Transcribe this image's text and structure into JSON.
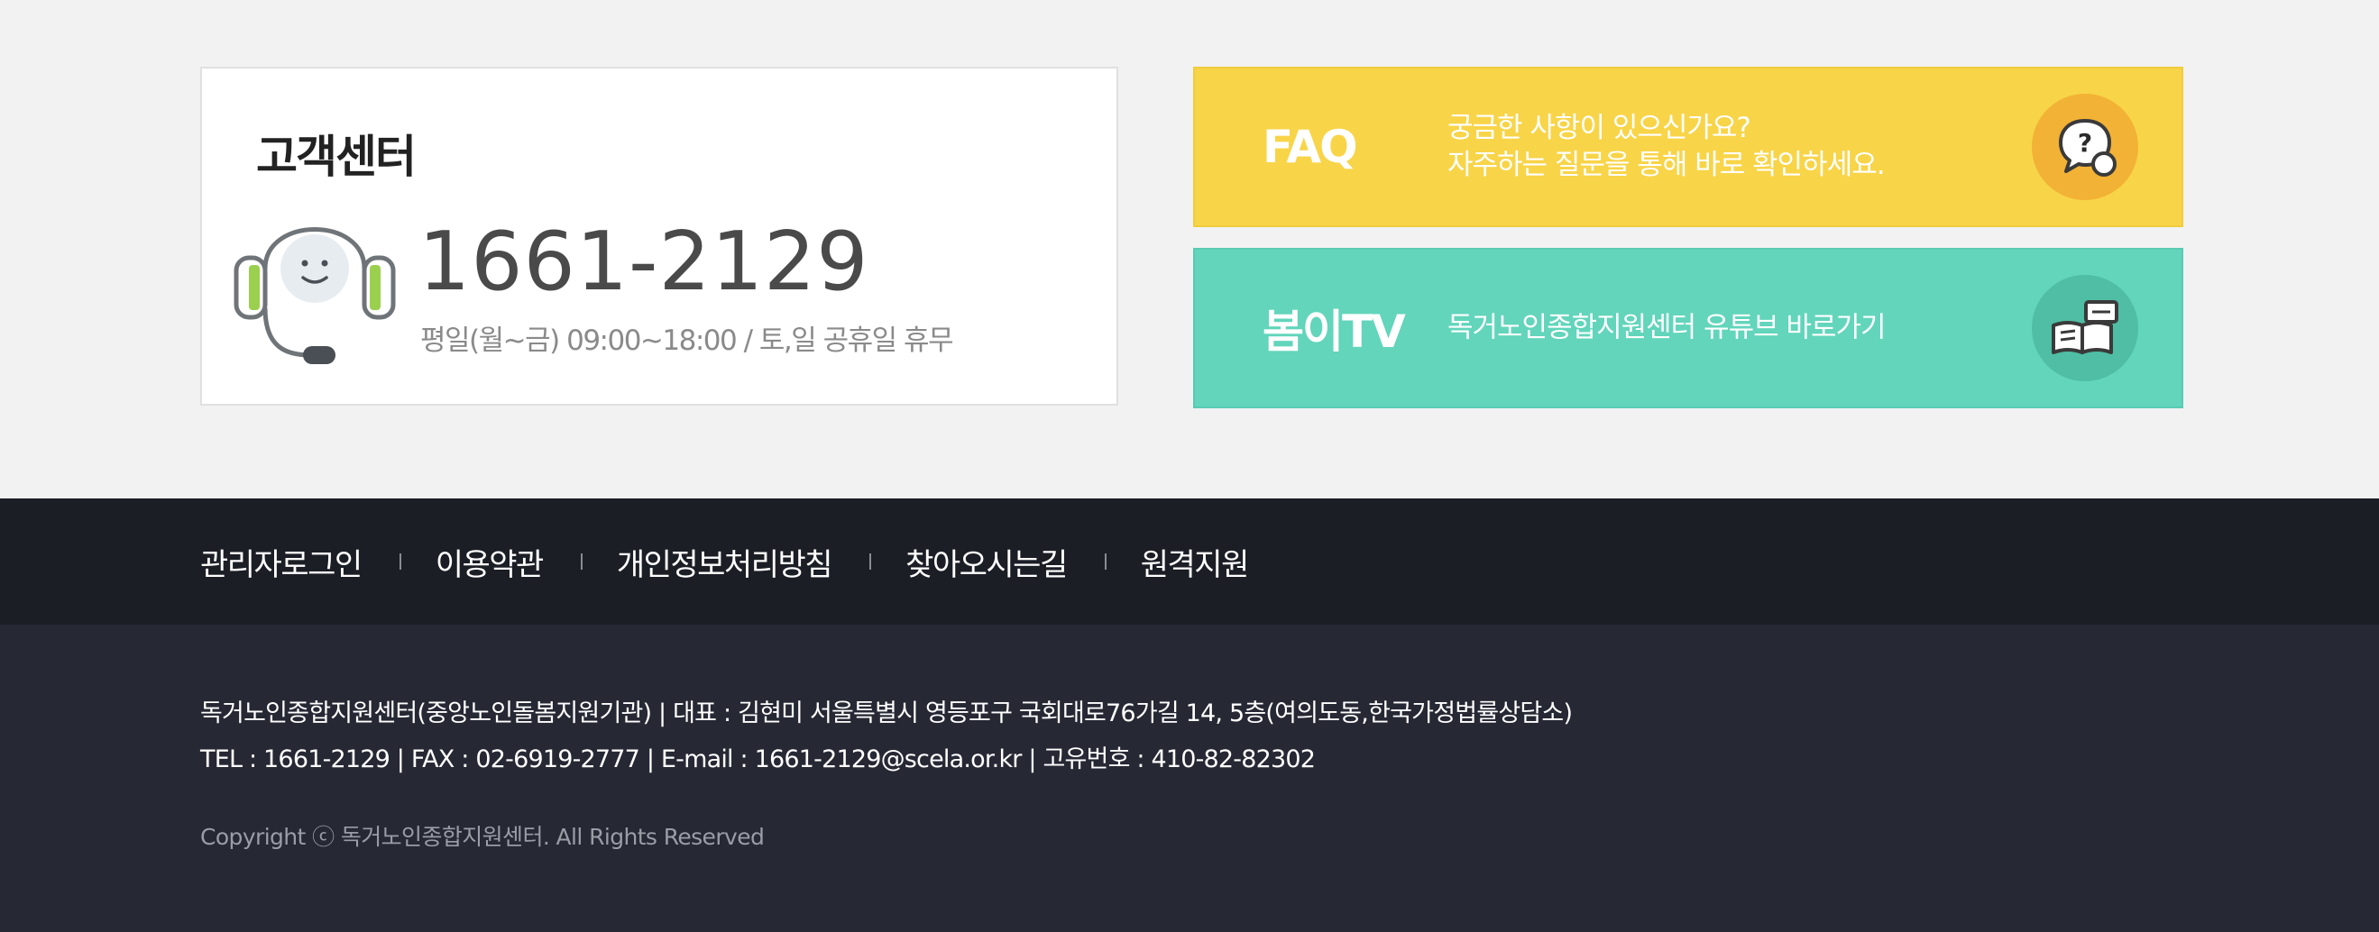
{
  "customer_center": {
    "title": "고객센터",
    "phone": "1661-2129",
    "hours": "평일(월~금) 09:00~18:00 / 토,일 공휴일 휴무",
    "icon": "headset-icon"
  },
  "faq_banner": {
    "title": "FAQ",
    "line1": "궁금한 사항이 있으신가요?",
    "line2": "자주하는 질문을 통해 바로 확인하세요.",
    "icon": "question-bubble-icon",
    "color": "#f8d448"
  },
  "tv_banner": {
    "title": "봄이TV",
    "line1": "독거노인종합지원센터 유튜브 바로가기",
    "icon": "book-chat-icon",
    "color": "#62d5bb"
  },
  "footer_nav": {
    "items": [
      {
        "label": "관리자로그인"
      },
      {
        "label": "이용약관"
      },
      {
        "label": "개인정보처리방침"
      },
      {
        "label": "찾아오시는길"
      },
      {
        "label": "원격지원"
      }
    ]
  },
  "footer_info": {
    "line1": "독거노인종합지원센터(중앙노인돌봄지원기관) | 대표 : 김현미 서울특별시 영등포구 국회대로76가길 14, 5층(여의도동,한국가정법률상담소)",
    "line2": "TEL : 1661-2129 | FAX : 02-6919-2777 | E-mail : 1661-2129@scela.or.kr | 고유번호 : 410-82-82302",
    "copyright": "Copyright ⓒ 독거노인종합지원센터. All Rights Reserved"
  }
}
